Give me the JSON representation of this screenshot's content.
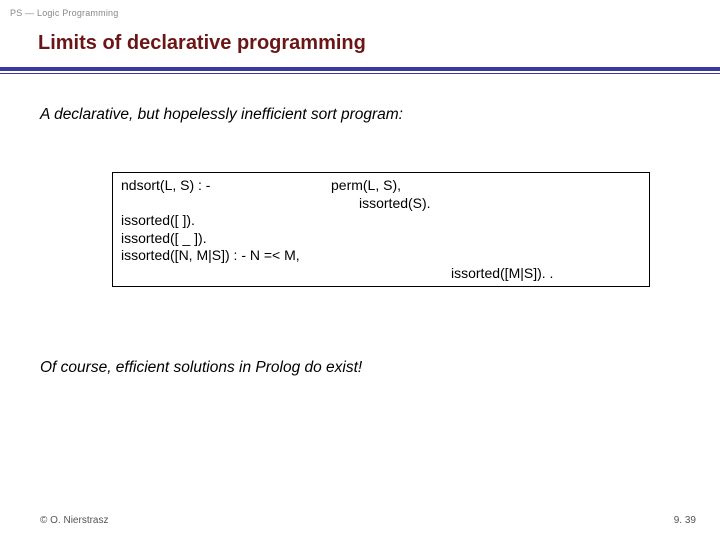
{
  "header": {
    "breadcrumb": "PS — Logic Programming",
    "title": "Limits of declarative programming"
  },
  "body": {
    "lead": "A declarative, but hopelessly inefficient sort program:",
    "code": {
      "r1_left": "ndsort(L, S) : -",
      "r1_right_a": "perm(L, S),",
      "r1_right_b": "issorted(S).",
      "r2": "issorted([ ]).",
      "r3": "issorted([ _ ]).",
      "r4_left": "issorted([N, M|S]) : - N =< M,",
      "r4_right": "issorted([M|S]). ."
    },
    "conclusion": "Of course, efficient solutions in Prolog do exist!"
  },
  "footer": {
    "copyright": "© O. Nierstrasz",
    "page": "9. 39"
  }
}
